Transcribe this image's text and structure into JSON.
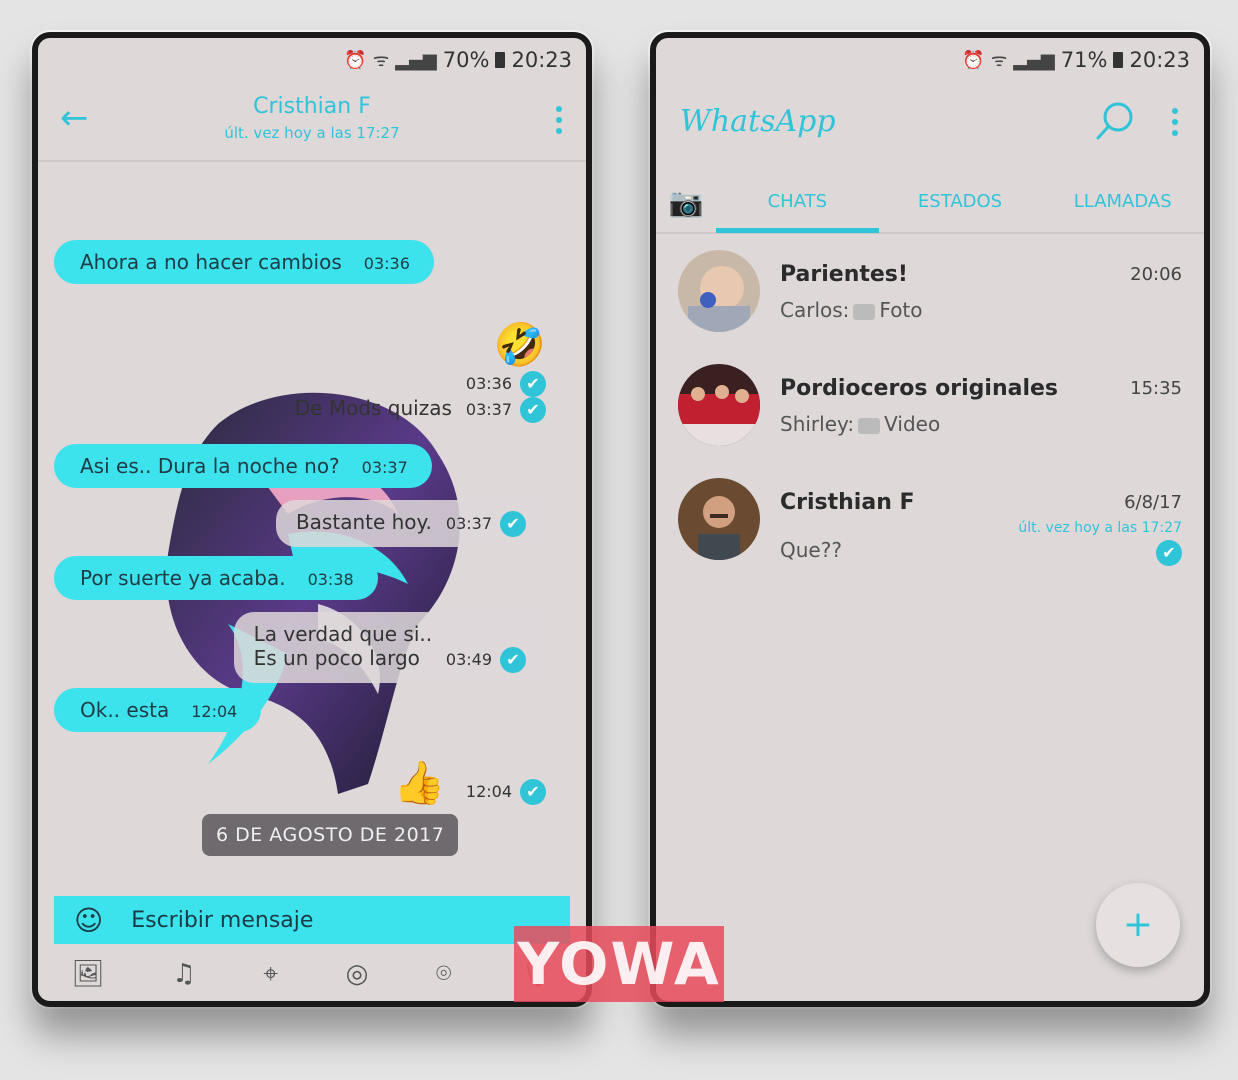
{
  "left": {
    "status": {
      "battery": "70%",
      "time": "20:23"
    },
    "header": {
      "contact_name": "Cristhian F",
      "last_seen": "últ. vez hoy a las 17:27"
    },
    "messages": [
      {
        "dir": "in",
        "text": "Ahora a no hacer cambios",
        "time": "03:36"
      },
      {
        "dir": "out",
        "emoji": "🤣",
        "time": "03:36"
      },
      {
        "dir": "out",
        "text": "De Mods  quizas",
        "time": "03:37"
      },
      {
        "dir": "in",
        "text": "Asi es.. Dura la noche no?",
        "time": "03:37"
      },
      {
        "dir": "out",
        "text": "Bastante hoy.",
        "time": "03:37"
      },
      {
        "dir": "in",
        "text": "Por suerte ya acaba.",
        "time": "03:38"
      },
      {
        "dir": "out",
        "text_line1": "La verdad que si..",
        "text_line2": "Es un poco largo",
        "time": "03:49"
      },
      {
        "dir": "in",
        "text": "Ok.. esta",
        "time": "12:04"
      },
      {
        "dir": "out",
        "emoji": "👍",
        "time": "12:04"
      }
    ],
    "date_chip": "6 DE AGOSTO DE 2017",
    "input": {
      "placeholder": "Escribir mensaje"
    }
  },
  "right": {
    "status": {
      "battery": "71%",
      "time": "20:23"
    },
    "app_title": "WhatsApp",
    "tabs": [
      "CHATS",
      "ESTADOS",
      "LLAMADAS"
    ],
    "chats": [
      {
        "name": "Parientes!",
        "preview_sender": "Carlos:",
        "preview_text": "Foto",
        "time": "20:06"
      },
      {
        "name": "Pordioceros originales",
        "preview_sender": "Shirley:",
        "preview_text": "Video",
        "time": "15:35"
      },
      {
        "name": "Cristhian F",
        "preview_text": "Que??",
        "time": "6/8/17",
        "status": "últ. vez hoy a las 17:27"
      }
    ],
    "fab_label": "+"
  },
  "watermark": "YOWA",
  "colors": {
    "accent": "#30c4d8",
    "bubble": "#3ce2ec",
    "background": "#ded8d9",
    "mic": "#e84b5a"
  }
}
